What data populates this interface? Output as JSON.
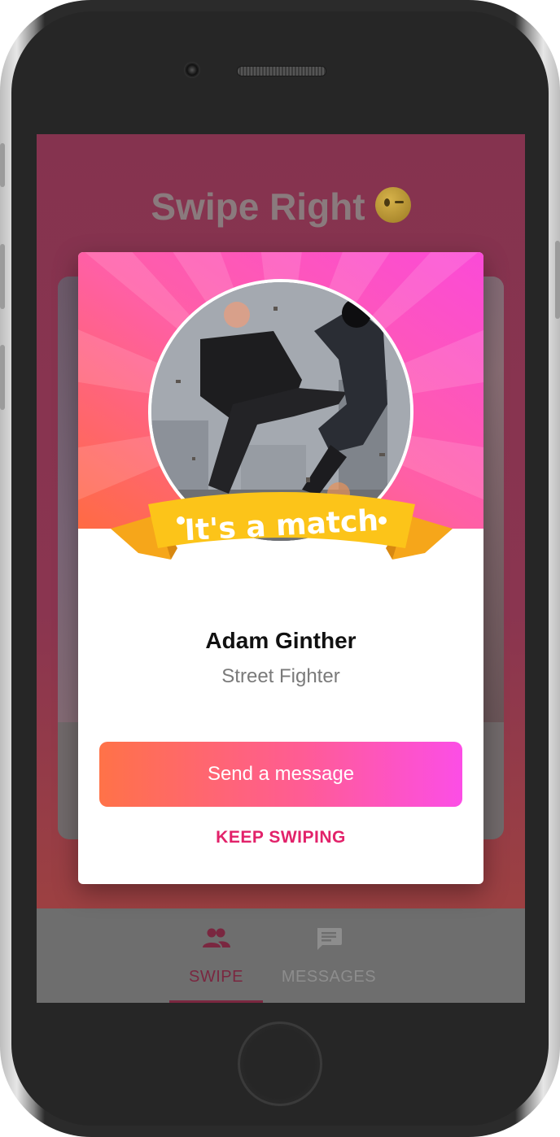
{
  "app": {
    "title": "Swipe Right",
    "title_emoji": "winking-face-emoji"
  },
  "match_dialog": {
    "banner_text": "It's a match",
    "name": "Adam Ginther",
    "subtitle": "Street Fighter",
    "primary_button": "Send a message",
    "secondary_button": "KEEP SWIPING"
  },
  "tabs": [
    {
      "label": "SWIPE",
      "icon": "people-icon",
      "active": true
    },
    {
      "label": "MESSAGES",
      "icon": "chat-icon",
      "active": false
    }
  ],
  "colors": {
    "accent": "#e2226a",
    "gradient_start": "#ff7248",
    "gradient_end": "#fc4ee6",
    "ribbon": "#fcc419",
    "tab_active_dimmed": "#7a2740",
    "tab_inactive_dimmed": "#8d8d8d"
  }
}
